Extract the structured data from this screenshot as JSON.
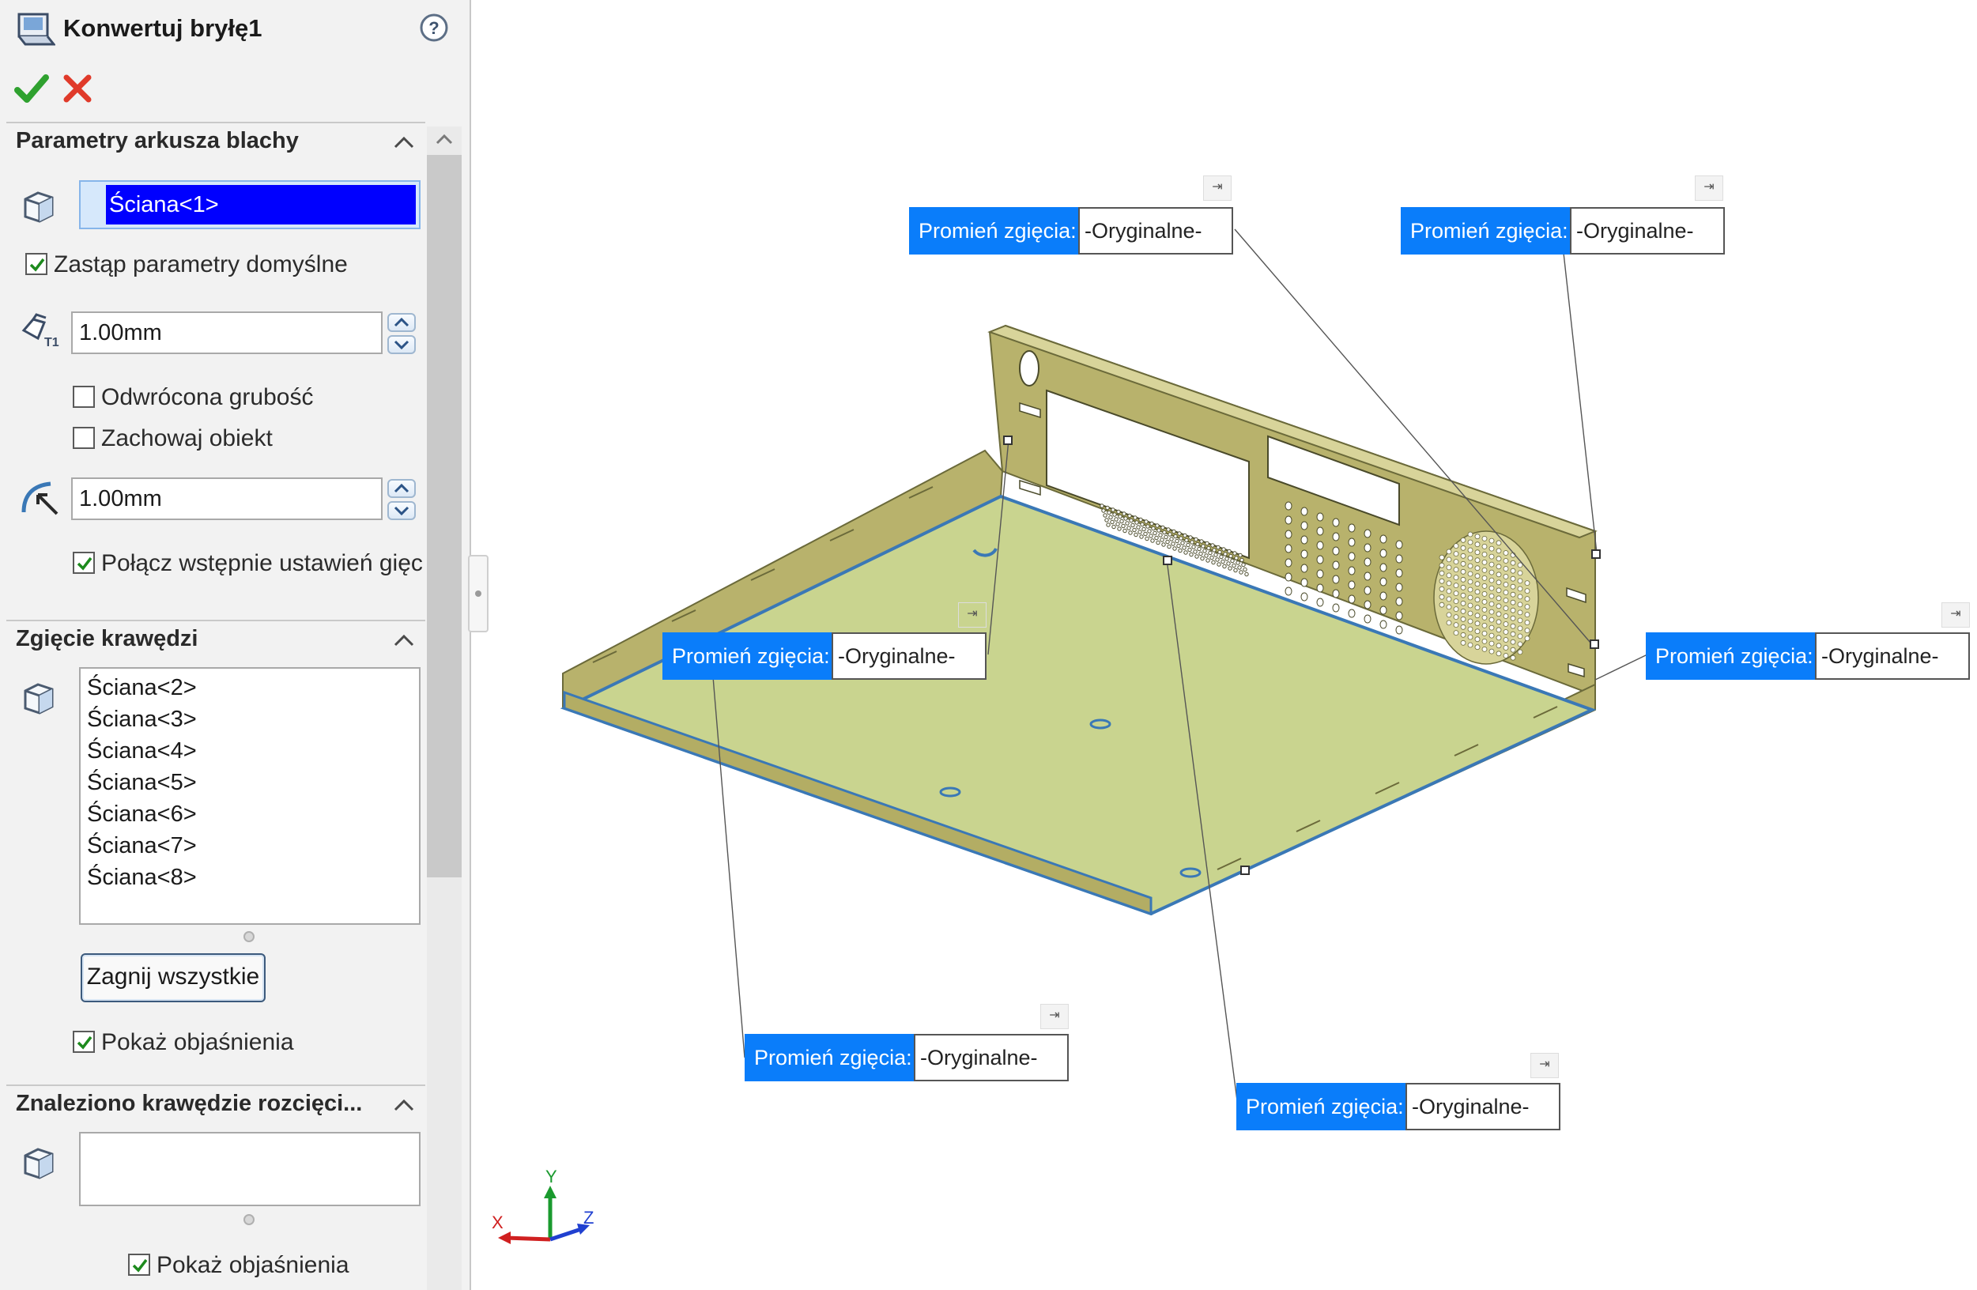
{
  "header": {
    "title": "Konwertuj bryłę1",
    "help_icon": "help-circle-icon",
    "ok_icon": "green-check-icon",
    "cancel_icon": "red-x-icon"
  },
  "sheet_params": {
    "title": "Parametry arkusza blachy",
    "fixed_face": "Ściana<1>",
    "override_default": "Zastąp parametry domyślne",
    "thickness": "1.00mm",
    "reverse_thickness": "Odwrócona grubość",
    "keep_body": "Zachowaj obiekt",
    "bend_radius": "1.00mm",
    "merge_preset": "Połącz wstępnie ustawień gięc"
  },
  "edge_bend": {
    "title": "Zgięcie krawędzi",
    "faces": [
      "Ściana<2>",
      "Ściana<3>",
      "Ściana<4>",
      "Ściana<5>",
      "Ściana<6>",
      "Ściana<7>",
      "Ściana<8>"
    ],
    "collect_all_button": "Zagnij wszystkie",
    "show_callouts": "Pokaż objaśnienia"
  },
  "rip_edges": {
    "title": "Znaleziono krawędzie rozcięci...",
    "show_callouts": "Pokaż objaśnienia"
  },
  "callouts": [
    {
      "label": "Promień zgięcia:",
      "value": "-Oryginalne-"
    },
    {
      "label": "Promień zgięcia:",
      "value": "-Oryginalne-"
    },
    {
      "label": "Promień zgięcia:",
      "value": "-Oryginalne-"
    },
    {
      "label": "Promień zgięcia:",
      "value": "-Oryginalne-"
    },
    {
      "label": "Promień zgięcia:",
      "value": "-Oryginalne-"
    },
    {
      "label": "Promień zgięcia:",
      "value": "-Oryginalne-"
    }
  ],
  "triad": {
    "x": "X",
    "y": "Y",
    "z": "Z"
  },
  "colors": {
    "accent_blue": "#0a7dfa",
    "selection_blue": "#0000ff",
    "part_face": "#c9d48f",
    "part_wall": "#b7b06a",
    "edge_blue": "#3a78b6"
  }
}
